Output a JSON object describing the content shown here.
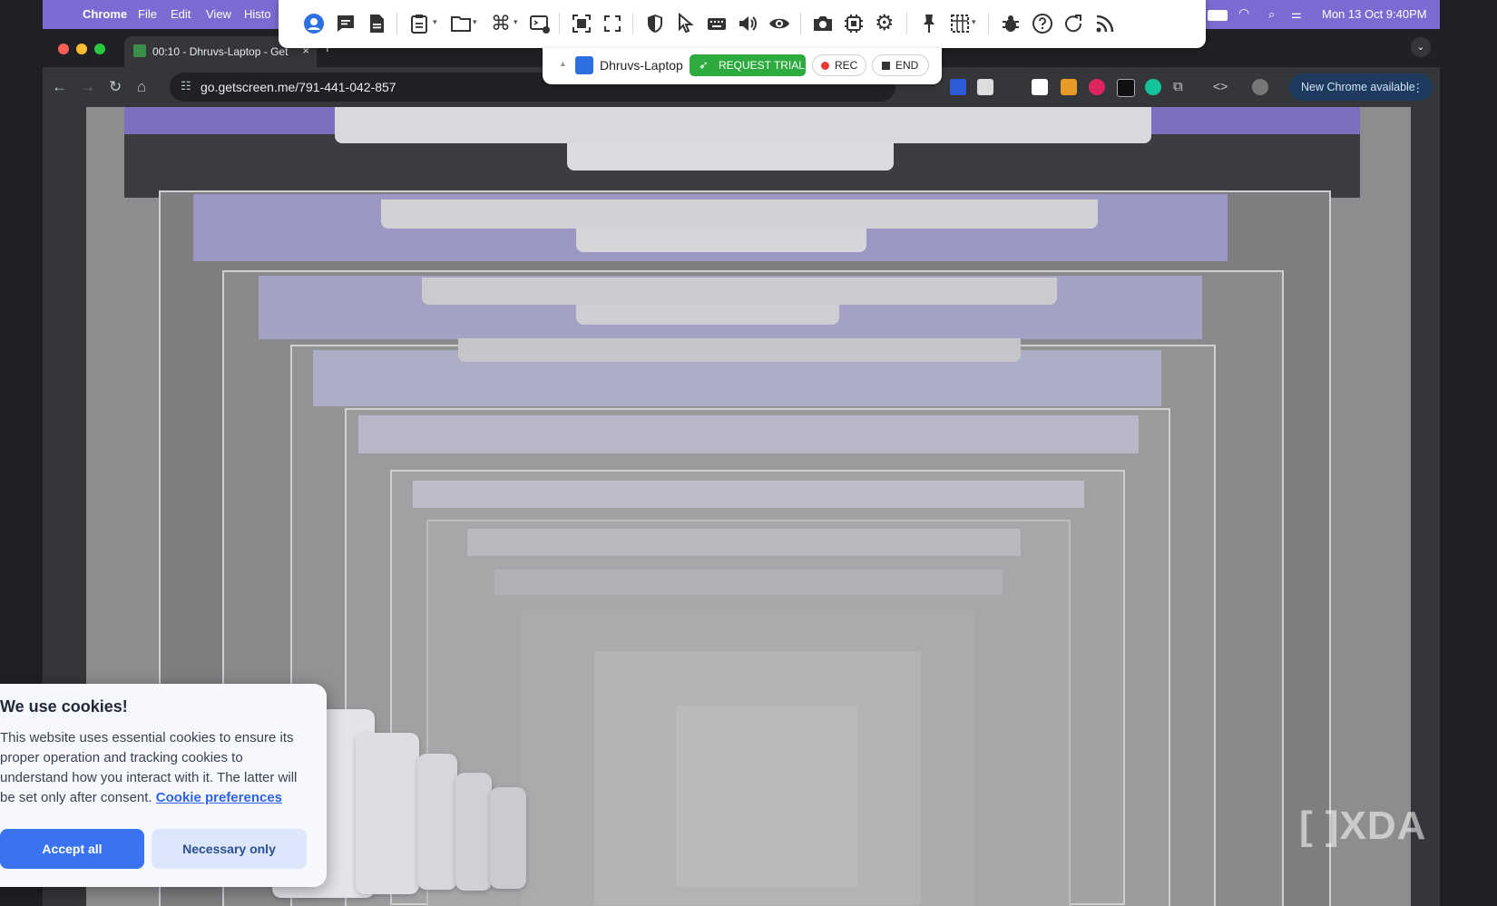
{
  "menubar": {
    "app": "Chrome",
    "items": [
      "File",
      "Edit",
      "View",
      "Histo"
    ],
    "clock": "Mon 13 Oct  9:40PM"
  },
  "tab": {
    "title": "00:10 - Dhruvs-Laptop - Get",
    "close": "×",
    "new": "+"
  },
  "navbar": {
    "url": "go.getscreen.me/791-441-042-857",
    "update_label": "New Chrome available"
  },
  "getscreen": {
    "device": "Dhruvs-Laptop",
    "trial_label": "REQUEST TRIAL",
    "rec_label": "REC",
    "end_label": "END",
    "icons": [
      "user-icon",
      "chat-icon",
      "file-icon",
      "clipboard-icon",
      "folder-icon",
      "command-icon",
      "terminal-icon",
      "fit-screen-icon",
      "fullscreen-icon",
      "shield-icon",
      "cursor-icon",
      "keyboard-icon",
      "volume-icon",
      "eye-icon",
      "camera-icon",
      "chip-icon",
      "gear-icon",
      "pin-icon",
      "grid-icon",
      "bug-icon",
      "help-icon",
      "refresh-icon",
      "rss-icon"
    ]
  },
  "cookie": {
    "title": "We use cookies!",
    "text": "This website uses essential cookies to ensure its proper operation and tracking cookies to understand how you interact with it. The latter will be set only after consent.",
    "link": "Cookie preferences",
    "accept": "Accept all",
    "necessary": "Necessary only"
  },
  "watermark": "XDA",
  "colors": {
    "menubar": "#7d6ad2",
    "trial": "#2dab3f",
    "accept": "#3a73f2",
    "rec_dot": "#e53935"
  }
}
